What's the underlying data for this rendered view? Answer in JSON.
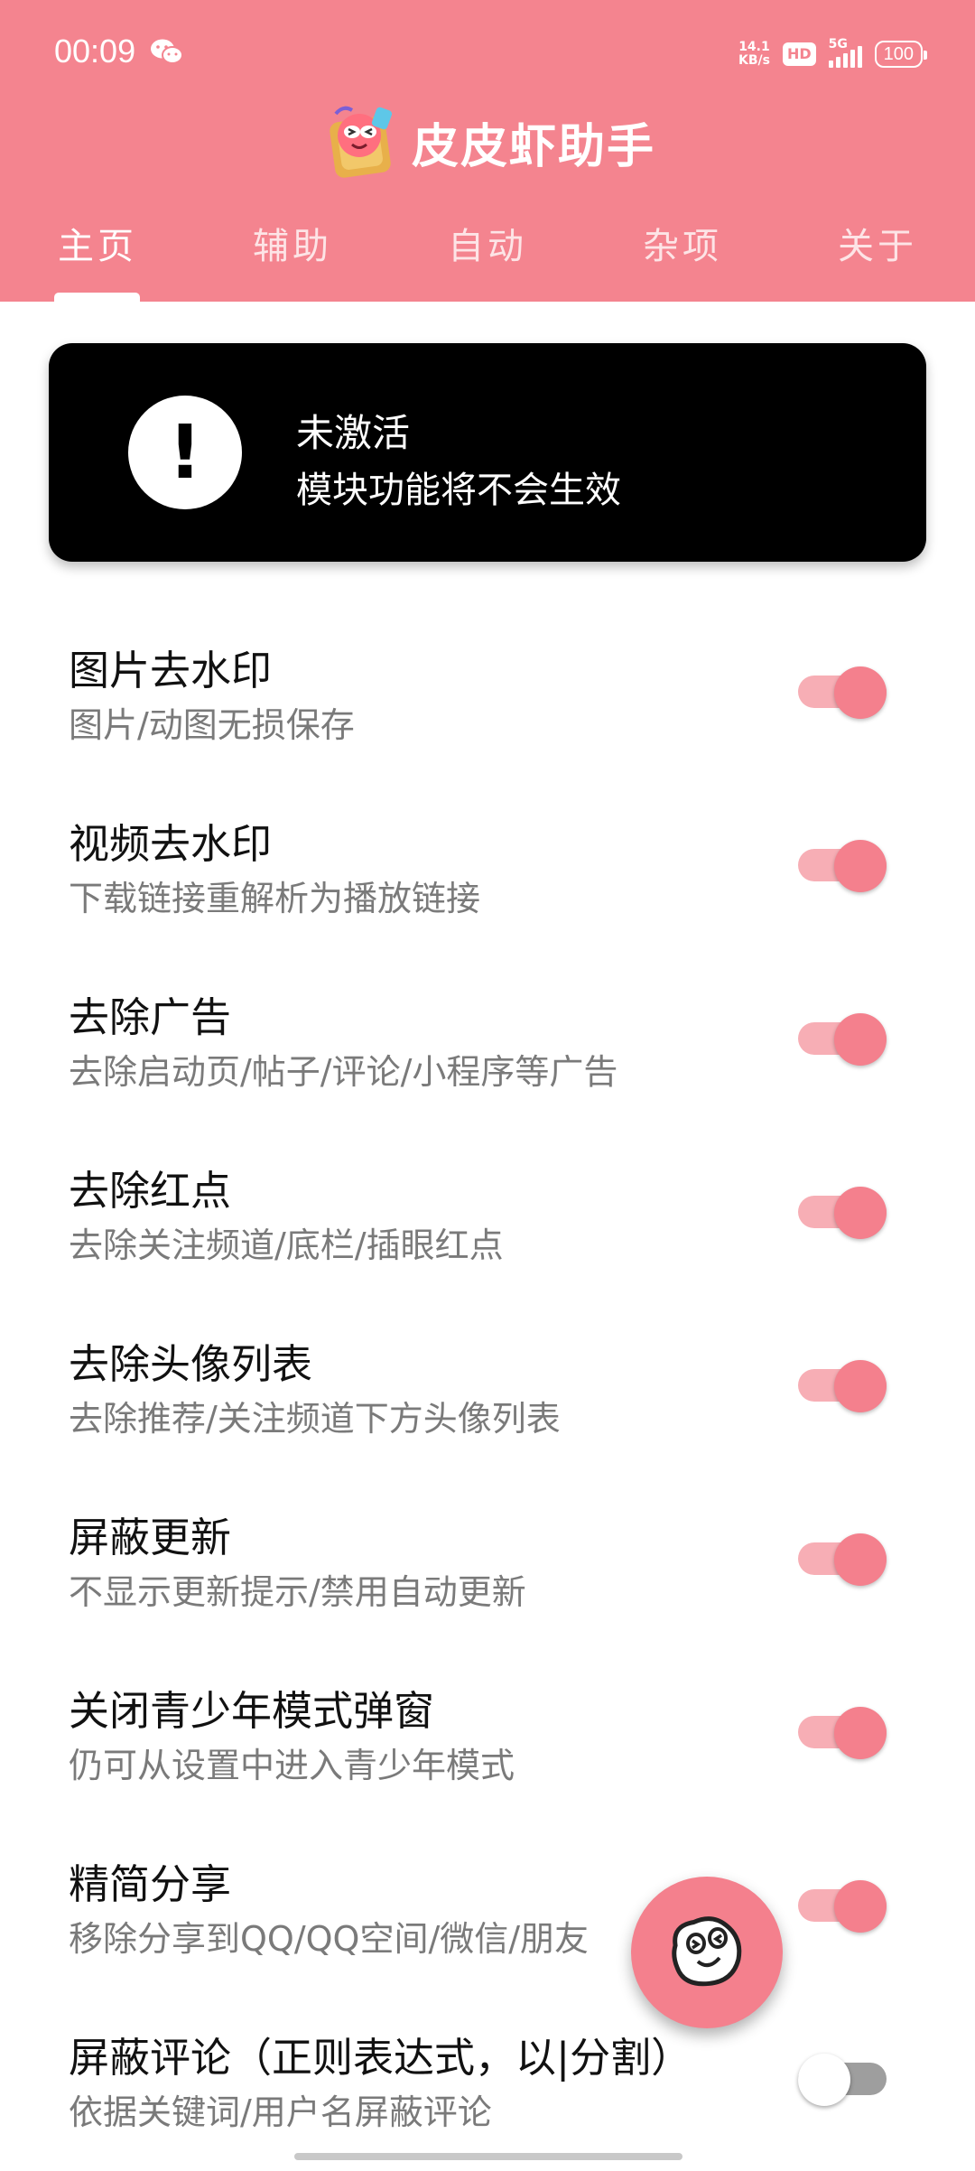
{
  "status_bar": {
    "time": "00:09",
    "net_speed_value": "14.1",
    "net_speed_unit": "KB/s",
    "hd": "HD",
    "network": "5G",
    "battery": "100"
  },
  "header": {
    "app_title": "皮皮虾助手",
    "tabs": [
      {
        "label": "主页",
        "active": true
      },
      {
        "label": "辅助",
        "active": false
      },
      {
        "label": "自动",
        "active": false
      },
      {
        "label": "杂项",
        "active": false
      },
      {
        "label": "关于",
        "active": false
      }
    ]
  },
  "alert": {
    "icon": "exclamation-icon",
    "title": "未激活",
    "subtitle": "模块功能将不会生效"
  },
  "settings": [
    {
      "title": "图片去水印",
      "subtitle": "图片/动图无损保存",
      "enabled": true
    },
    {
      "title": "视频去水印",
      "subtitle": "下载链接重解析为播放链接",
      "enabled": true
    },
    {
      "title": "去除广告",
      "subtitle": "去除启动页/帖子/评论/小程序等广告",
      "enabled": true
    },
    {
      "title": "去除红点",
      "subtitle": "去除关注频道/底栏/插眼红点",
      "enabled": true
    },
    {
      "title": "去除头像列表",
      "subtitle": "去除推荐/关注频道下方头像列表",
      "enabled": true
    },
    {
      "title": "屏蔽更新",
      "subtitle": "不显示更新提示/禁用自动更新",
      "enabled": true
    },
    {
      "title": "关闭青少年模式弹窗",
      "subtitle": "仍可从设置中进入青少年模式",
      "enabled": true
    },
    {
      "title": "精简分享",
      "subtitle": "移除分享到QQ/QQ空间/微信/朋友",
      "enabled": true
    },
    {
      "title": "屏蔽评论（正则表达式，以|分割）",
      "subtitle": "依据关键词/用户名屏蔽评论",
      "enabled": false
    }
  ],
  "colors": {
    "header_bg": "#f4848f",
    "switch_on_thumb": "#f4808d",
    "switch_on_track": "#f7aeb5",
    "alert_bg": "#000000"
  },
  "fab": {
    "icon": "smiley-face-icon"
  }
}
